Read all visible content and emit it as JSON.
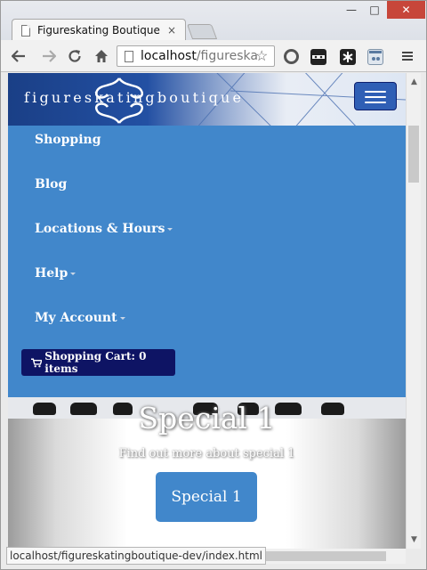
{
  "browser": {
    "tab_title": "Figureskating Boutique",
    "tab_close": "×",
    "window_controls": {
      "minimize": "—",
      "maximize": "□",
      "close": "✕"
    },
    "url_host": "localhost",
    "url_path": "/figureska",
    "toolbar_icons": [
      "back-icon",
      "forward-icon",
      "reload-icon",
      "home-icon",
      "page-icon",
      "star-icon"
    ],
    "extension_icons": [
      "extension-circle-icon",
      "extension-mask-icon",
      "extension-asterisk-icon",
      "extension-window-icon",
      "menu-icon"
    ]
  },
  "site": {
    "brand": "figureskatingboutique",
    "brand_color": "#1f4c9a",
    "menu_color": "#4187cb",
    "menu": [
      {
        "label": "Shopping",
        "dropdown": false
      },
      {
        "label": "Blog",
        "dropdown": false
      },
      {
        "label": "Locations & Hours",
        "dropdown": true
      },
      {
        "label": "Help",
        "dropdown": true
      },
      {
        "label": "My Account",
        "dropdown": true
      }
    ],
    "cart": {
      "label": "Shopping Cart: 0 items",
      "color": "#0e1464"
    },
    "hero": {
      "title": "Special 1",
      "subtitle": "Find out more about special 1",
      "button": "Special 1"
    }
  },
  "status_bar": {
    "text": "localhost/figureskatingboutique-dev/index.html"
  }
}
